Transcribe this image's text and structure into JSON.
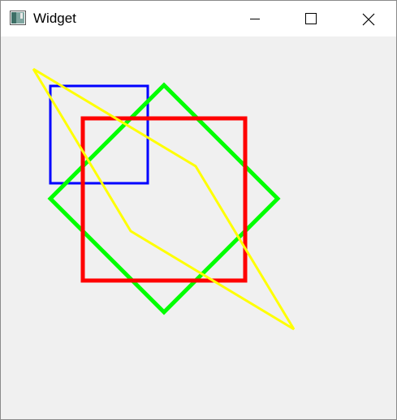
{
  "window": {
    "title": "Widget",
    "controls": {
      "minimize": "minimize-icon",
      "maximize": "maximize-icon",
      "close": "close-icon"
    }
  },
  "colors": {
    "background": "#f0f0f0",
    "blue_square": "#0000ff",
    "green_diamond": "#00ff00",
    "red_square": "#ff0000",
    "yellow_polygon": "#ffff00"
  }
}
